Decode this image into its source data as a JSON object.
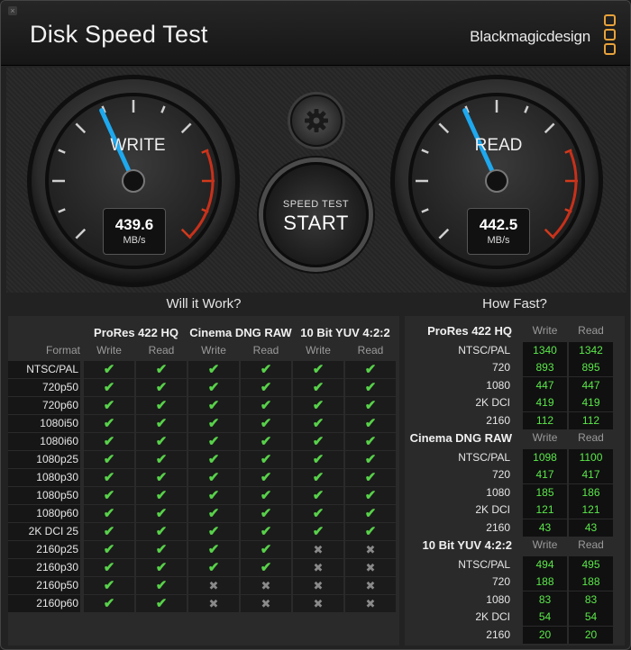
{
  "window": {
    "title": "Disk Speed Test",
    "brand": "Blackmagicdesign",
    "close_glyph": "×"
  },
  "gauges": {
    "write": {
      "label": "WRITE",
      "value": "439.6",
      "unit": "MB/s",
      "needle_fraction": 0.41
    },
    "read": {
      "label": "READ",
      "value": "442.5",
      "unit": "MB/s",
      "needle_fraction": 0.41
    }
  },
  "controls": {
    "settings_icon": "gear-icon",
    "start_small": "SPEED TEST",
    "start_big": "START"
  },
  "will_it_work": {
    "title": "Will it Work?",
    "groups": [
      "ProRes 422 HQ",
      "Cinema DNG RAW",
      "10 Bit YUV 4:2:2"
    ],
    "format_header": "Format",
    "write_label": "Write",
    "read_label": "Read",
    "ok_glyph": "✔",
    "no_glyph": "✖",
    "rows": [
      {
        "format": "NTSC/PAL",
        "cells": [
          1,
          1,
          1,
          1,
          1,
          1
        ]
      },
      {
        "format": "720p50",
        "cells": [
          1,
          1,
          1,
          1,
          1,
          1
        ]
      },
      {
        "format": "720p60",
        "cells": [
          1,
          1,
          1,
          1,
          1,
          1
        ]
      },
      {
        "format": "1080i50",
        "cells": [
          1,
          1,
          1,
          1,
          1,
          1
        ]
      },
      {
        "format": "1080i60",
        "cells": [
          1,
          1,
          1,
          1,
          1,
          1
        ]
      },
      {
        "format": "1080p25",
        "cells": [
          1,
          1,
          1,
          1,
          1,
          1
        ]
      },
      {
        "format": "1080p30",
        "cells": [
          1,
          1,
          1,
          1,
          1,
          1
        ]
      },
      {
        "format": "1080p50",
        "cells": [
          1,
          1,
          1,
          1,
          1,
          1
        ]
      },
      {
        "format": "1080p60",
        "cells": [
          1,
          1,
          1,
          1,
          1,
          1
        ]
      },
      {
        "format": "2K DCI 25",
        "cells": [
          1,
          1,
          1,
          1,
          1,
          1
        ]
      },
      {
        "format": "2160p25",
        "cells": [
          1,
          1,
          1,
          1,
          0,
          0
        ]
      },
      {
        "format": "2160p30",
        "cells": [
          1,
          1,
          1,
          1,
          0,
          0
        ]
      },
      {
        "format": "2160p50",
        "cells": [
          1,
          1,
          0,
          0,
          0,
          0
        ]
      },
      {
        "format": "2160p60",
        "cells": [
          1,
          1,
          0,
          0,
          0,
          0
        ]
      }
    ]
  },
  "how_fast": {
    "title": "How Fast?",
    "write_label": "Write",
    "read_label": "Read",
    "groups": [
      {
        "name": "ProRes 422 HQ",
        "rows": [
          {
            "format": "NTSC/PAL",
            "write": "1340",
            "read": "1342"
          },
          {
            "format": "720",
            "write": "893",
            "read": "895"
          },
          {
            "format": "1080",
            "write": "447",
            "read": "447"
          },
          {
            "format": "2K DCI",
            "write": "419",
            "read": "419"
          },
          {
            "format": "2160",
            "write": "112",
            "read": "112"
          }
        ]
      },
      {
        "name": "Cinema DNG RAW",
        "rows": [
          {
            "format": "NTSC/PAL",
            "write": "1098",
            "read": "1100"
          },
          {
            "format": "720",
            "write": "417",
            "read": "417"
          },
          {
            "format": "1080",
            "write": "185",
            "read": "186"
          },
          {
            "format": "2K DCI",
            "write": "121",
            "read": "121"
          },
          {
            "format": "2160",
            "write": "43",
            "read": "43"
          }
        ]
      },
      {
        "name": "10 Bit YUV 4:2:2",
        "rows": [
          {
            "format": "NTSC/PAL",
            "write": "494",
            "read": "495"
          },
          {
            "format": "720",
            "write": "188",
            "read": "188"
          },
          {
            "format": "1080",
            "write": "83",
            "read": "83"
          },
          {
            "format": "2K DCI",
            "write": "54",
            "read": "54"
          },
          {
            "format": "2160",
            "write": "20",
            "read": "20"
          }
        ]
      }
    ]
  },
  "colors": {
    "needle": "#1ea8ee",
    "ok": "#58d24a",
    "speed_value": "#5be84a",
    "brand_accent": "#e8a23a"
  }
}
